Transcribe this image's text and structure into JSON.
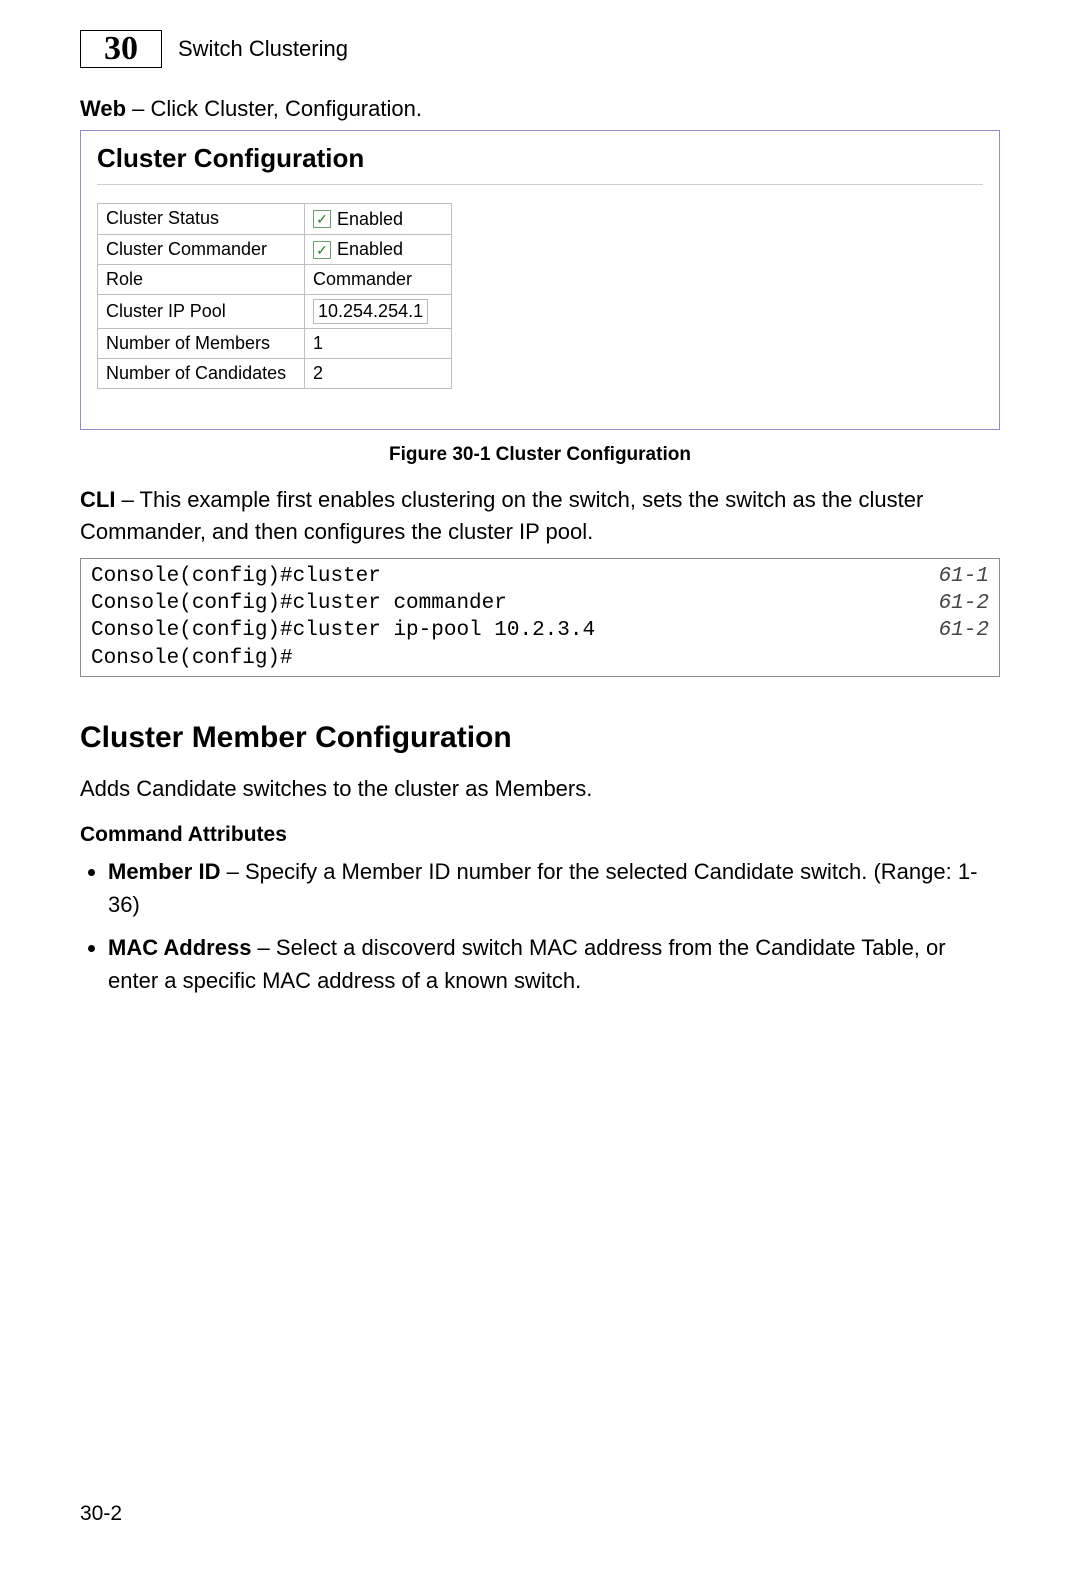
{
  "chapter": {
    "number": "30",
    "title": "Switch Clustering"
  },
  "web_instruction": {
    "label": "Web",
    "text": " – Click Cluster, Configuration."
  },
  "figure": {
    "panel_title": "Cluster Configuration",
    "rows": {
      "cluster_status_label": "Cluster Status",
      "cluster_status_enabled": "Enabled",
      "cluster_commander_label": "Cluster Commander",
      "cluster_commander_enabled": "Enabled",
      "role_label": "Role",
      "role_value": "Commander",
      "ip_pool_label": "Cluster IP Pool",
      "ip_pool_value": "10.254.254.1",
      "members_label": "Number of Members",
      "members_value": "1",
      "candidates_label": "Number of Candidates",
      "candidates_value": "2"
    },
    "caption": "Figure 30-1  Cluster Configuration"
  },
  "cli": {
    "label": "CLI",
    "text": " – This example first enables clustering on the switch, sets the switch as the cluster Commander, and then configures the cluster IP pool.",
    "lines": [
      {
        "cmd": "Console(config)#cluster",
        "ref": "61-1"
      },
      {
        "cmd": "Console(config)#cluster commander",
        "ref": "61-2"
      },
      {
        "cmd": "Console(config)#cluster ip-pool 10.2.3.4",
        "ref": "61-2"
      },
      {
        "cmd": "Console(config)#",
        "ref": ""
      }
    ]
  },
  "section": {
    "heading": "Cluster Member Configuration",
    "intro": "Adds Candidate switches to the cluster as Members.",
    "subheading": "Command Attributes",
    "items": [
      {
        "term": "Member ID",
        "desc": " – Specify a Member ID number for the selected Candidate switch. (Range: 1-36)"
      },
      {
        "term": "MAC Address",
        "desc": " – Select a discoverd switch MAC address from the Candidate Table, or enter a specific MAC address of a known switch."
      }
    ]
  },
  "page_number": "30-2"
}
